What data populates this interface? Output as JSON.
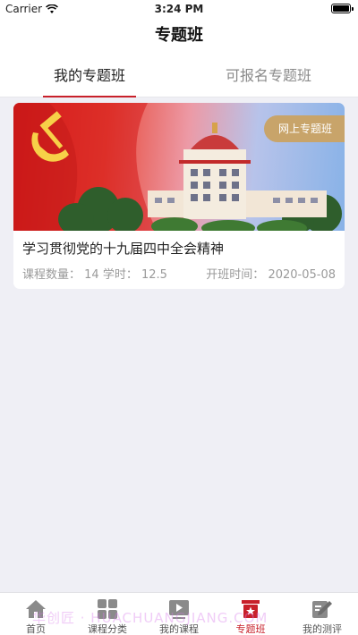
{
  "status_bar": {
    "carrier": "Carrier",
    "time": "3:24 PM"
  },
  "header": {
    "title": "专题班"
  },
  "tabs": [
    {
      "label": "我的专题班",
      "active": true
    },
    {
      "label": "可报名专题班",
      "active": false
    }
  ],
  "course_card": {
    "badge": "网上专题班",
    "title": "学习贯彻党的十九届四中全会精神",
    "course_count_label": "课程数量：",
    "course_count_value": "14",
    "hours_label": "学时：",
    "hours_value": "12.5",
    "start_label": "开班时间：",
    "start_value": "2020-05-08"
  },
  "tab_bar": {
    "items": [
      {
        "label": "首页",
        "icon": "home-icon",
        "active": false
      },
      {
        "label": "课程分类",
        "icon": "grid-icon",
        "active": false
      },
      {
        "label": "我的课程",
        "icon": "play-icon",
        "active": false
      },
      {
        "label": "专题班",
        "icon": "special-class-icon",
        "active": true
      },
      {
        "label": "我的测评",
        "icon": "evaluation-icon",
        "active": false
      }
    ]
  },
  "watermark": "华创匠 · HUACHUANGJIANG.COM",
  "colors": {
    "accent": "#c8202a",
    "badge": "#c8a46a",
    "background": "#efeff5"
  }
}
